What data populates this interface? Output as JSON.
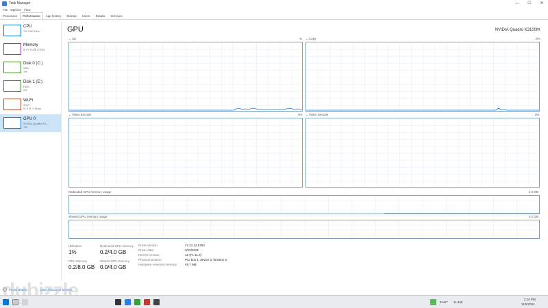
{
  "window": {
    "title": "Task Manager",
    "minimize": "—",
    "maximize": "☐",
    "close": "✕"
  },
  "menu": [
    "File",
    "Options",
    "View"
  ],
  "tabs": [
    {
      "label": "Processes",
      "active": false
    },
    {
      "label": "Performance",
      "active": true
    },
    {
      "label": "App history",
      "active": false
    },
    {
      "label": "Startup",
      "active": false
    },
    {
      "label": "Users",
      "active": false
    },
    {
      "label": "Details",
      "active": false
    },
    {
      "label": "Services",
      "active": false
    }
  ],
  "sidebar": [
    {
      "name": "CPU",
      "sub1": "7% 3.60 GHz",
      "sub2": "",
      "color": "#1874cd",
      "selected": false
    },
    {
      "name": "Memory",
      "sub1": "5.7/7.9 GB (72%)",
      "sub2": "",
      "color": "#8b3aa6",
      "selected": false
    },
    {
      "name": "Disk 0 (C:)",
      "sub1": "SSD",
      "sub2": "1%",
      "color": "#4d8a2e",
      "selected": false
    },
    {
      "name": "Disk 1 (E:)",
      "sub1": "HDD",
      "sub2": "0%",
      "color": "#4d8a2e",
      "selected": false
    },
    {
      "name": "Wi-Fi",
      "sub1": "Wi-Fi",
      "sub2": "S: 0 R: 0 Kbps",
      "color": "#a0522d",
      "selected": false
    },
    {
      "name": "GPU 0",
      "sub1": "NVIDIA Quadro K3...",
      "sub2": "1%",
      "color": "#1874cd",
      "selected": true
    }
  ],
  "main": {
    "title": "GPU",
    "model": "NVIDIA Quadro K3100M",
    "graphs": [
      {
        "label": "3D",
        "pct": "%"
      },
      {
        "label": "Copy",
        "pct": "0%"
      },
      {
        "label": "Video Encode",
        "pct": "0%"
      },
      {
        "label": "Video Decode",
        "pct": "0%"
      }
    ],
    "dedicated_memory_label": "Dedicated GPU memory usage",
    "dedicated_memory_value": "4.0 GB",
    "shared_memory_label": "Shared GPU memory usage",
    "shared_memory_value": "4.0 GB"
  },
  "stats": {
    "utilization_label": "Utilization",
    "utilization_value": "1%",
    "dedicated_label": "Dedicated GPU memory",
    "dedicated_value": "0.2/4.0 GB",
    "gpu_memory_label": "GPU Memory",
    "gpu_memory_value": "0.2/8.0 GB",
    "shared_label": "Shared GPU memory",
    "shared_value": "0.0/4.0 GB"
  },
  "info": [
    {
      "key": "Driver version:",
      "value": "27.21.14.5750"
    },
    {
      "key": "Driver date:",
      "value": "3/12/2021"
    },
    {
      "key": "DirectX version:",
      "value": "12 (FL 11.0)"
    },
    {
      "key": "Physical location:",
      "value": "PCI bus 1, device 0, function 0"
    },
    {
      "key": "Hardware reserved memory:",
      "value": "45.7 MB"
    }
  ],
  "footer": {
    "fewer_details": "Fewer details",
    "open_resource_monitor": "Open Resource Monitor"
  },
  "taskbar": {
    "weather": "EAST",
    "tray": "11,450",
    "time": "2:16 PM",
    "date": "11/5/2024"
  },
  "colors": {
    "gpu_line": "#1874cd",
    "graph_border": "#7aa0c6",
    "grid": "#e6eef6"
  }
}
